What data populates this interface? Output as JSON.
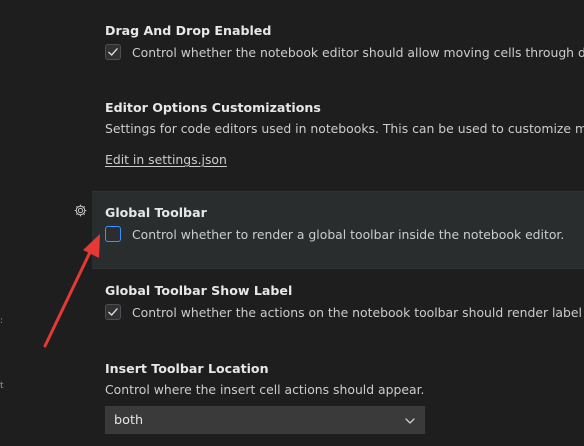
{
  "settings": {
    "drag_drop": {
      "title": "Drag And Drop Enabled",
      "description": "Control whether the notebook editor should allow moving cells through drag a",
      "checked": true
    },
    "editor_options": {
      "title": "Editor Options Customizations",
      "description": "Settings for code editors used in notebooks. This can be used to customize most ed",
      "link": "Edit in settings.json"
    },
    "global_toolbar": {
      "title": "Global Toolbar",
      "description": "Control whether to render a global toolbar inside the notebook editor.",
      "checked": false
    },
    "show_label": {
      "title": "Global Toolbar Show Label",
      "description": "Control whether the actions on the notebook toolbar should render label or no",
      "checked": true
    },
    "insert_toolbar": {
      "title": "Insert Toolbar Location",
      "description": "Control where the insert cell actions should appear.",
      "value": "both"
    }
  },
  "left_marks": [
    ":",
    "t"
  ],
  "icons": {
    "gear": "gear-icon",
    "check": "check-icon",
    "dropdown": "chevron-down-icon"
  },
  "colors": {
    "background": "#1e1e1e",
    "active_row": "#2a2d2e",
    "focus_border": "#3794ff",
    "annotation_arrow": "#e53935"
  }
}
